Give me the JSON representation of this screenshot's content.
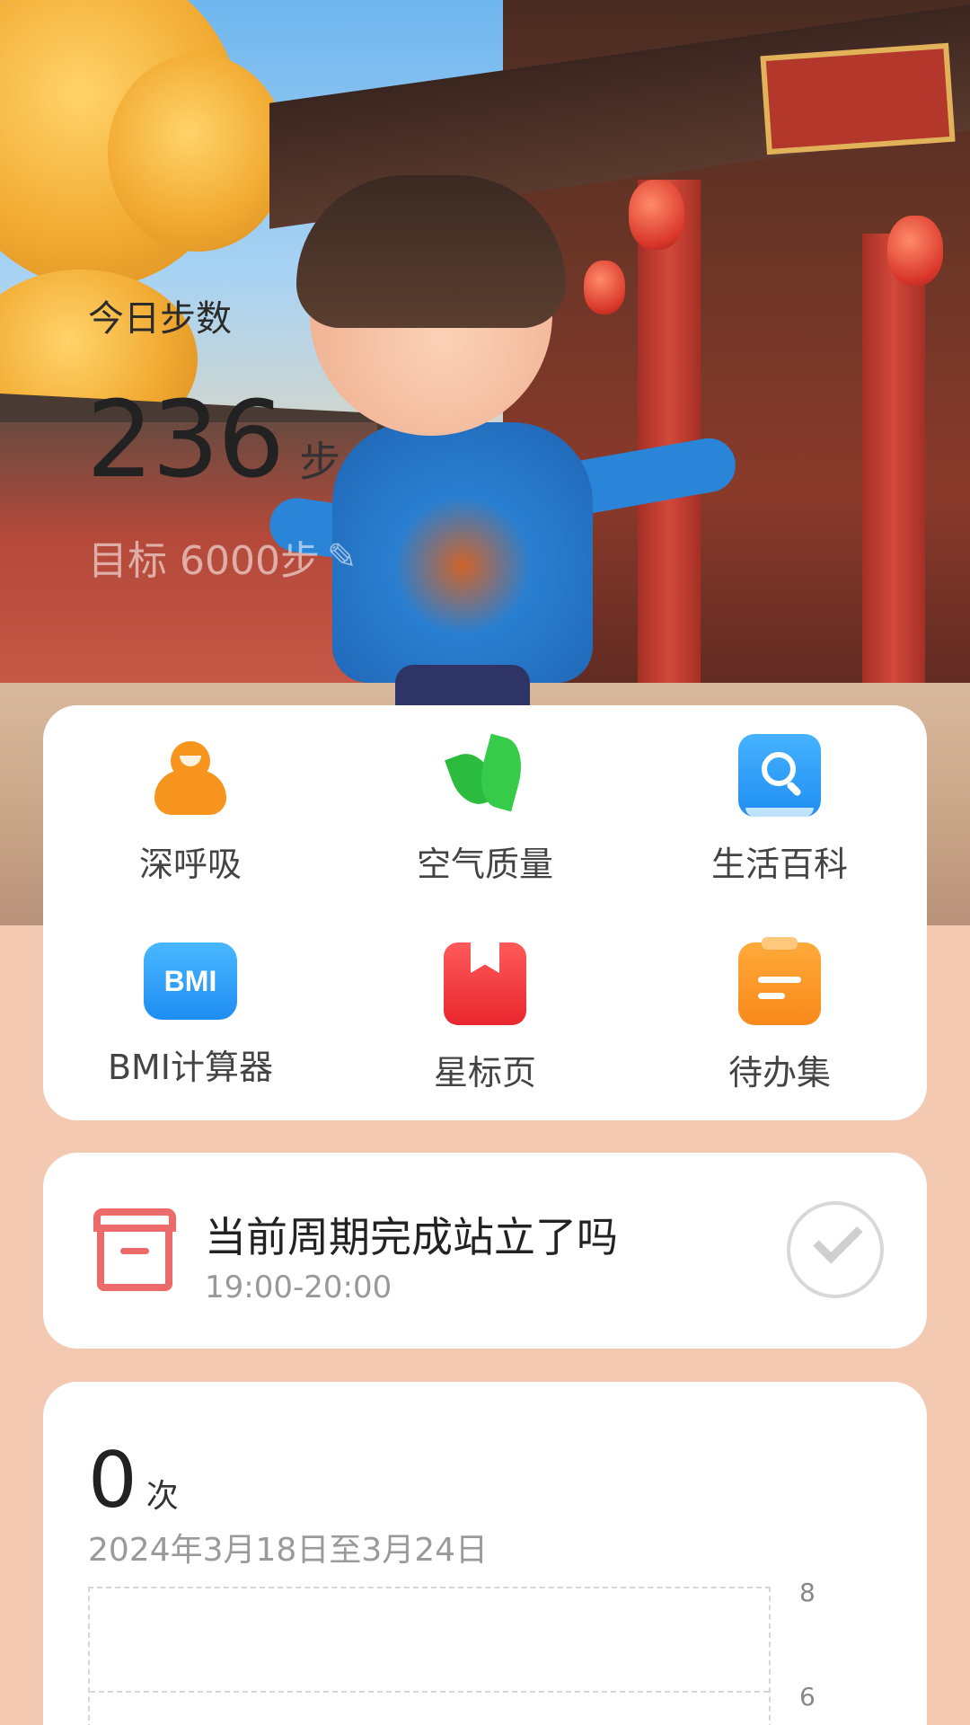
{
  "steps": {
    "title": "今日步数",
    "value": "236",
    "unit": "步",
    "goal": "目标 6000步"
  },
  "tools": [
    {
      "label": "深呼吸",
      "icon": "breath-icon"
    },
    {
      "label": "空气质量",
      "icon": "leaf-icon"
    },
    {
      "label": "生活百科",
      "icon": "search-book-icon"
    },
    {
      "label": "BMI计算器",
      "icon": "bmi-icon",
      "icon_text": "BMI"
    },
    {
      "label": "星标页",
      "icon": "bookmark-icon"
    },
    {
      "label": "待办集",
      "icon": "clipboard-icon"
    }
  ],
  "reminder": {
    "title": "当前周期完成站立了吗",
    "time": "19:00-20:00",
    "icon": "box-icon",
    "check_icon": "check-icon"
  },
  "stats": {
    "value": "0",
    "unit": "次",
    "range": "2024年3月18日至3月24日",
    "y_ticks": [
      "8",
      "6"
    ]
  },
  "colors": {
    "background": "#f3c9b2",
    "card": "#ffffff",
    "accent_red": "#ec6a6a",
    "accent_orange": "#f7941d",
    "accent_blue": "#1f8ef2"
  }
}
